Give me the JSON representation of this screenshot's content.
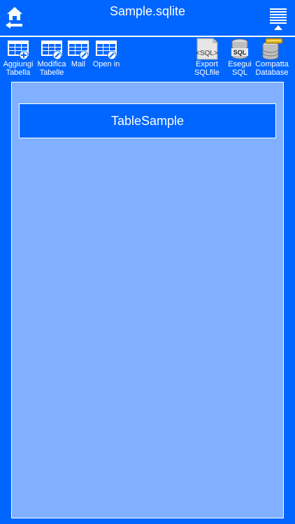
{
  "header": {
    "title": "Sample.sqlite"
  },
  "toolbar": {
    "add_table": {
      "line1": "Aggiungi",
      "line2": "Tabella"
    },
    "edit_tables": {
      "line1": "Modifica",
      "line2": "Tabelle"
    },
    "mail": {
      "line1": "Mail"
    },
    "open_in": {
      "line1": "Open in"
    },
    "export_sql": {
      "line1": "Export",
      "line2": "SQLfile",
      "icon_text": "<SQL>"
    },
    "run_sql": {
      "line1": "Esegui",
      "line2": "SQL",
      "icon_text": "SQL"
    },
    "compact_db": {
      "line1": "Compatta",
      "line2": "Database"
    }
  },
  "tables": [
    {
      "name": "TableSample"
    }
  ],
  "colors": {
    "background": "#0066ff",
    "panel": "#80b0ff",
    "accent": "#ffffff"
  }
}
